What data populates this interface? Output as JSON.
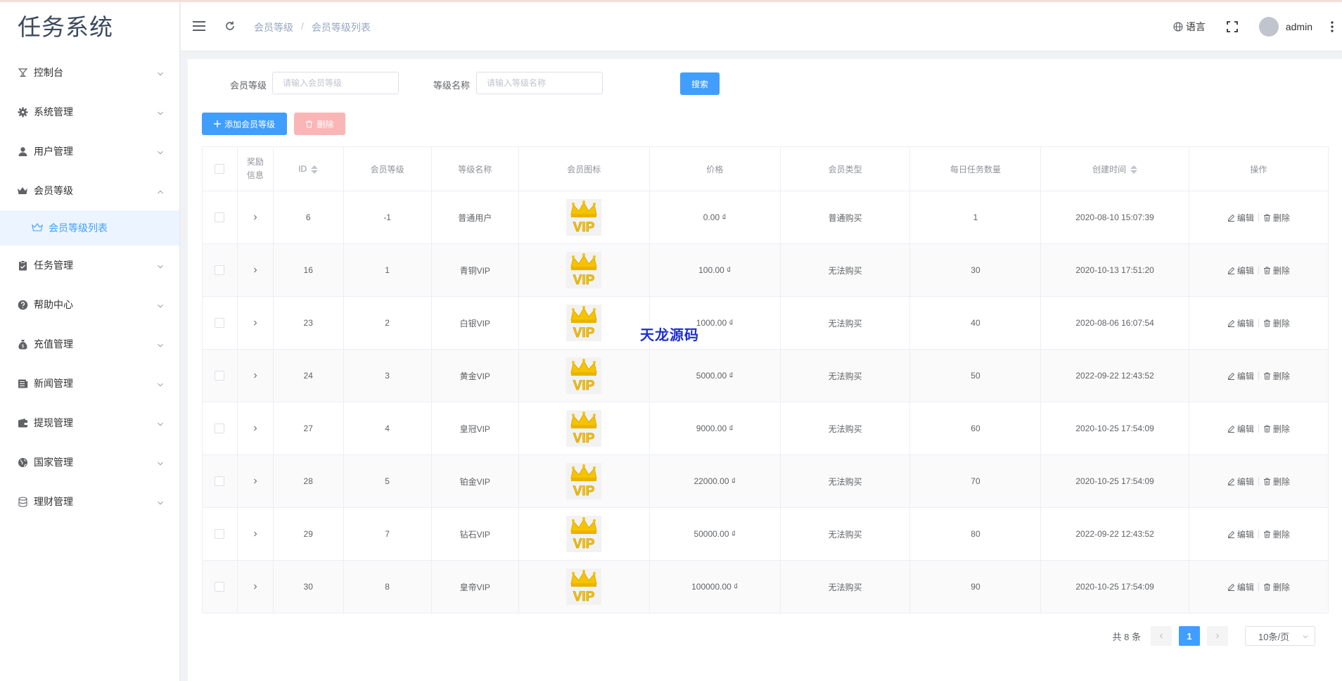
{
  "app": {
    "logo": "任务系统"
  },
  "sidebar": {
    "items": [
      {
        "label": "控制台",
        "icon": "dashboard-icon"
      },
      {
        "label": "系统管理",
        "icon": "gear-icon"
      },
      {
        "label": "用户管理",
        "icon": "user-icon"
      },
      {
        "label": "会员等级",
        "icon": "crown-icon",
        "expanded": true,
        "children": [
          {
            "label": "会员等级列表",
            "icon": "crown-outline-icon",
            "active": true
          }
        ]
      },
      {
        "label": "任务管理",
        "icon": "clipboard-icon"
      },
      {
        "label": "帮助中心",
        "icon": "question-icon"
      },
      {
        "label": "充值管理",
        "icon": "money-bag-icon"
      },
      {
        "label": "新闻管理",
        "icon": "news-icon"
      },
      {
        "label": "提现管理",
        "icon": "wallet-icon"
      },
      {
        "label": "国家管理",
        "icon": "globe-icon"
      },
      {
        "label": "理财管理",
        "icon": "database-icon"
      }
    ]
  },
  "header": {
    "breadcrumb": [
      "会员等级",
      "会员等级列表"
    ],
    "breadcrumb_sep": "/",
    "language": "语言",
    "username": "admin"
  },
  "search": {
    "level_label": "会员等级",
    "level_placeholder": "请输入会员等级",
    "name_label": "等级名称",
    "name_placeholder": "请输入等级名称",
    "search_button": "搜索"
  },
  "toolbar": {
    "add_label": "添加会员等级",
    "delete_label": "删除"
  },
  "table": {
    "headers": {
      "reward": "奖励信息",
      "id": "ID",
      "level": "会员等级",
      "name": "等级名称",
      "icon": "会员图标",
      "price": "价格",
      "type": "会员类型",
      "daily": "每日任务数量",
      "created": "创建时间",
      "ops": "操作"
    },
    "edit_label": "编辑",
    "delete_label": "删除",
    "rows": [
      {
        "id": "6",
        "level": "-1",
        "name": "普通用户",
        "price": "0.00 ₫",
        "type": "普通购买",
        "daily": "1",
        "created": "2020-08-10 15:07:39"
      },
      {
        "id": "16",
        "level": "1",
        "name": "青铜VIP",
        "price": "100.00 ₫",
        "type": "无法购买",
        "daily": "30",
        "created": "2020-10-13 17:51:20"
      },
      {
        "id": "23",
        "level": "2",
        "name": "白银VIP",
        "price": "1000.00 ₫",
        "type": "无法购买",
        "daily": "40",
        "created": "2020-08-06 16:07:54"
      },
      {
        "id": "24",
        "level": "3",
        "name": "黄金VIP",
        "price": "5000.00 ₫",
        "type": "无法购买",
        "daily": "50",
        "created": "2022-09-22 12:43:52"
      },
      {
        "id": "27",
        "level": "4",
        "name": "皇冠VIP",
        "price": "9000.00 ₫",
        "type": "无法购买",
        "daily": "60",
        "created": "2020-10-25 17:54:09"
      },
      {
        "id": "28",
        "level": "5",
        "name": "铂金VIP",
        "price": "22000.00 ₫",
        "type": "无法购买",
        "daily": "70",
        "created": "2020-10-25 17:54:09"
      },
      {
        "id": "29",
        "level": "7",
        "name": "钻石VIP",
        "price": "50000.00 ₫",
        "type": "无法购买",
        "daily": "80",
        "created": "2022-09-22 12:43:52"
      },
      {
        "id": "30",
        "level": "8",
        "name": "皇帝VIP",
        "price": "100000.00 ₫",
        "type": "无法购买",
        "daily": "90",
        "created": "2020-10-25 17:54:09"
      }
    ]
  },
  "vip_badge_text": "VIP",
  "watermark": "天龙源码",
  "pagination": {
    "total": "共 8 条",
    "current_page": "1",
    "page_size": "10条/页"
  },
  "colors": {
    "primary": "#409eff",
    "danger_disabled": "#fab6b6",
    "crown_gold": "#f5c400",
    "watermark": "#1e2fd0"
  }
}
